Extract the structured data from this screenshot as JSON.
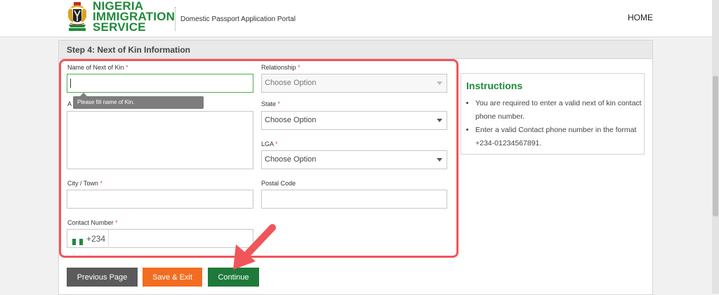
{
  "header": {
    "logo_line1": "NIGERIA",
    "logo_line2": "IMMIGRATION",
    "logo_line3": "SERVICE",
    "portal_title": "Domestic Passport Application Portal",
    "nav_home": "HOME"
  },
  "form": {
    "step_title": "Step 4: Next of Kin Information",
    "required_mark": "*",
    "name_label": "Name of Next of Kin",
    "name_value": "",
    "name_tooltip": "Please fill name of Kin.",
    "address_label_visible": "A",
    "relationship_label": "Relationship",
    "relationship_value": "Choose Option",
    "state_label": "State",
    "state_value": "Choose Option",
    "lga_label": "LGA",
    "lga_value": "Choose Option",
    "city_label": "City / Town",
    "postal_label": "Postal Code",
    "contact_label": "Contact Number",
    "phone_code": "+234"
  },
  "instructions": {
    "title": "Instructions",
    "items": [
      "You are required to enter a valid next of kin contact phone number.",
      "Enter a valid Contact phone number in the format +234-01234567891."
    ]
  },
  "buttons": {
    "previous": "Previous Page",
    "save_exit": "Save & Exit",
    "continue": "Continue"
  },
  "colors": {
    "brand_green": "#1f8a3a",
    "continue_green": "#1e7a3a",
    "save_orange": "#f26d21",
    "previous_gray": "#5b5b5b",
    "highlight_red": "#f0555a"
  }
}
